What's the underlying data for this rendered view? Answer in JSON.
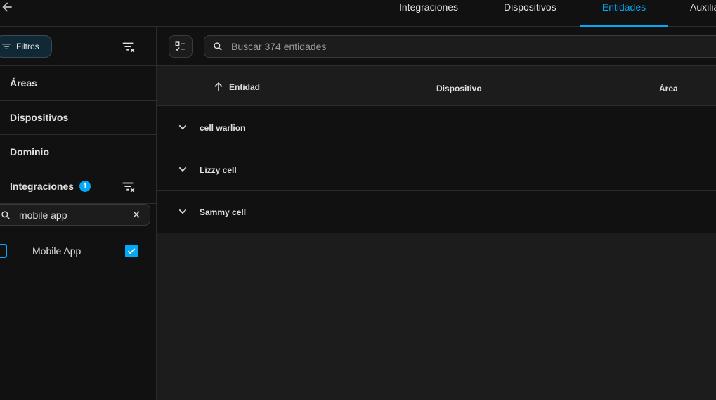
{
  "tabs": [
    {
      "label": "Integraciones",
      "active": false
    },
    {
      "label": "Dispositivos",
      "active": false
    },
    {
      "label": "Entidades",
      "active": true
    },
    {
      "label": "Auxilia",
      "active": false
    }
  ],
  "sidebar": {
    "filters_label": "Filtros",
    "sections": [
      {
        "label": "Áreas"
      },
      {
        "label": "Dispositivos"
      },
      {
        "label": "Dominio"
      },
      {
        "label": "Integraciones",
        "badge": "1"
      }
    ],
    "integration_search": {
      "value": "mobile app"
    },
    "integration_items": [
      {
        "label": "Mobile App",
        "checked": true
      }
    ]
  },
  "main": {
    "search_placeholder": "Buscar 374 entidades",
    "columns": [
      {
        "label": "Entidad",
        "sorted": "asc"
      },
      {
        "label": "Dispositivo"
      },
      {
        "label": "Área"
      }
    ],
    "groups": [
      {
        "label": "cell warlion"
      },
      {
        "label": "Lizzy cell"
      },
      {
        "label": "Sammy cell"
      }
    ]
  },
  "colors": {
    "accent": "#03a9f4",
    "background": "#111111",
    "surface": "#1c1c1c",
    "divider": "#2c2c2c"
  },
  "icons": {
    "back": "arrow-left-icon",
    "filter": "filter-icon",
    "clear_filters": "filter-remove-icon",
    "search": "search-icon",
    "close": "close-icon",
    "select_mode": "checklist-icon",
    "sort": "arrow-up-icon",
    "expand": "chevron-down-icon",
    "check": "check-icon",
    "mobile_app": "mobile-app-logo"
  }
}
